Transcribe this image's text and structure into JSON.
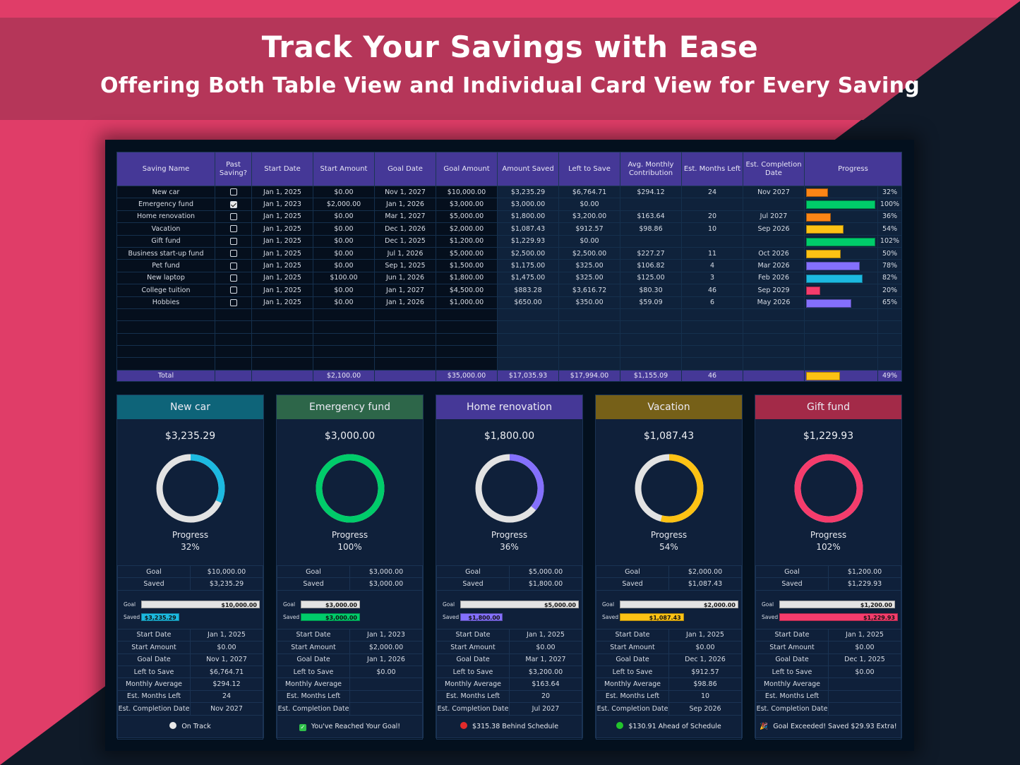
{
  "banner": {
    "title": "Track Your Savings with Ease",
    "subtitle": "Offering Both Table View and Individual Card View for Every Saving"
  },
  "colors": {
    "pink": "#e03d68",
    "banner": "#b53659",
    "dark": "#0f1a28",
    "header_purple": "#453897",
    "orange": "#fb8516",
    "green": "#00cc6a",
    "yellow": "#fdc214",
    "violet": "#8470fd",
    "cyan": "#1cb9e0",
    "red": "#f53c6c",
    "gray": "#e3e3e3"
  },
  "table": {
    "headers": [
      "Saving Name",
      "Past Saving?",
      "Start Date",
      "Start Amount",
      "Goal Date",
      "Goal Amount",
      "Amount Saved",
      "Left to Save",
      "Avg. Monthly Contribution",
      "Est. Months Left",
      "Est. Completion Date",
      "Progress"
    ],
    "rows": [
      {
        "name": "New car",
        "past": false,
        "start_date": "Jan 1, 2025",
        "start_amount": "$0.00",
        "goal_date": "Nov 1, 2027",
        "goal_amount": "$10,000.00",
        "saved": "$3,235.29",
        "left": "$6,764.71",
        "avg": "$294.12",
        "months": "24",
        "completion": "Nov 2027",
        "progress": 0.32,
        "progress_label": "32%",
        "bar_color": "#fb8516"
      },
      {
        "name": "Emergency fund",
        "past": true,
        "start_date": "Jan 1, 2023",
        "start_amount": "$2,000.00",
        "goal_date": "Jan 1, 2026",
        "goal_amount": "$3,000.00",
        "saved": "$3,000.00",
        "left": "$0.00",
        "avg": "",
        "months": "",
        "completion": "",
        "progress": 1.0,
        "progress_label": "100%",
        "bar_color": "#00cc6a"
      },
      {
        "name": "Home renovation",
        "past": false,
        "start_date": "Jan 1, 2025",
        "start_amount": "$0.00",
        "goal_date": "Mar 1, 2027",
        "goal_amount": "$5,000.00",
        "saved": "$1,800.00",
        "left": "$3,200.00",
        "avg": "$163.64",
        "months": "20",
        "completion": "Jul 2027",
        "progress": 0.36,
        "progress_label": "36%",
        "bar_color": "#fb8516"
      },
      {
        "name": "Vacation",
        "past": false,
        "start_date": "Jan 1, 2025",
        "start_amount": "$0.00",
        "goal_date": "Dec 1, 2026",
        "goal_amount": "$2,000.00",
        "saved": "$1,087.43",
        "left": "$912.57",
        "avg": "$98.86",
        "months": "10",
        "completion": "Sep 2026",
        "progress": 0.54,
        "progress_label": "54%",
        "bar_color": "#fdc214"
      },
      {
        "name": "Gift fund",
        "past": false,
        "start_date": "Jan 1, 2025",
        "start_amount": "$0.00",
        "goal_date": "Dec 1, 2025",
        "goal_amount": "$1,200.00",
        "saved": "$1,229.93",
        "left": "$0.00",
        "avg": "",
        "months": "",
        "completion": "",
        "progress": 1.02,
        "progress_label": "102%",
        "bar_color": "#00cc6a"
      },
      {
        "name": "Business start-up fund",
        "past": false,
        "start_date": "Jan 1, 2025",
        "start_amount": "$0.00",
        "goal_date": "Jul 1, 2026",
        "goal_amount": "$5,000.00",
        "saved": "$2,500.00",
        "left": "$2,500.00",
        "avg": "$227.27",
        "months": "11",
        "completion": "Oct 2026",
        "progress": 0.5,
        "progress_label": "50%",
        "bar_color": "#fdc214"
      },
      {
        "name": "Pet fund",
        "past": false,
        "start_date": "Jan 1, 2025",
        "start_amount": "$0.00",
        "goal_date": "Sep 1, 2025",
        "goal_amount": "$1,500.00",
        "saved": "$1,175.00",
        "left": "$325.00",
        "avg": "$106.82",
        "months": "4",
        "completion": "Mar 2026",
        "progress": 0.78,
        "progress_label": "78%",
        "bar_color": "#8470fd"
      },
      {
        "name": "New laptop",
        "past": false,
        "start_date": "Jan 1, 2025",
        "start_amount": "$100.00",
        "goal_date": "Jun 1, 2026",
        "goal_amount": "$1,800.00",
        "saved": "$1,475.00",
        "left": "$325.00",
        "avg": "$125.00",
        "months": "3",
        "completion": "Feb 2026",
        "progress": 0.82,
        "progress_label": "82%",
        "bar_color": "#1cb9e0"
      },
      {
        "name": "College tuition",
        "past": false,
        "start_date": "Jan 1, 2025",
        "start_amount": "$0.00",
        "goal_date": "Jan 1, 2027",
        "goal_amount": "$4,500.00",
        "saved": "$883.28",
        "left": "$3,616.72",
        "avg": "$80.30",
        "months": "46",
        "completion": "Sep 2029",
        "progress": 0.2,
        "progress_label": "20%",
        "bar_color": "#f53c6c"
      },
      {
        "name": "Hobbies",
        "past": false,
        "start_date": "Jan 1, 2025",
        "start_amount": "$0.00",
        "goal_date": "Jan 1, 2026",
        "goal_amount": "$1,000.00",
        "saved": "$650.00",
        "left": "$350.00",
        "avg": "$59.09",
        "months": "6",
        "completion": "May 2026",
        "progress": 0.65,
        "progress_label": "65%",
        "bar_color": "#8470fd"
      }
    ],
    "empty_rows": 5,
    "total": {
      "label": "Total",
      "start_amount": "$2,100.00",
      "goal_amount": "$35,000.00",
      "saved": "$17,035.93",
      "left": "$17,994.00",
      "avg": "$1,155.09",
      "months": "46",
      "progress": 0.49,
      "progress_label": "49%",
      "bar_color": "#fdc214"
    }
  },
  "cards": [
    {
      "name": "New car",
      "header_color": "#0e6479",
      "amount": "$3,235.29",
      "ring_color": "#1cb9e0",
      "progress": 0.32,
      "progress_title": "Progress",
      "progress_label": "32%",
      "goal_label": "Goal",
      "goal": "$10,000.00",
      "saved_label": "Saved",
      "saved": "$3,235.29",
      "mini_goal_frac": 1.0,
      "mini_saved_frac": 0.32,
      "details": [
        [
          "Start Date",
          "Jan 1, 2025"
        ],
        [
          "Start Amount",
          "$0.00"
        ],
        [
          "Goal Date",
          "Nov 1, 2027"
        ],
        [
          "Left to Save",
          "$6,764.71"
        ],
        [
          "Monthly Average",
          "$294.12"
        ],
        [
          "Est. Months Left",
          "24"
        ],
        [
          "Est. Completion Date",
          "Nov 2027"
        ]
      ],
      "status_icon": "white-circle",
      "status_color": "#e8e8e8",
      "status": "On Track"
    },
    {
      "name": "Emergency fund",
      "header_color": "#2d6649",
      "amount": "$3,000.00",
      "ring_color": "#00cc6a",
      "progress": 1.0,
      "progress_title": "Progress",
      "progress_label": "100%",
      "goal_label": "Goal",
      "goal": "$3,000.00",
      "saved_label": "Saved",
      "saved": "$3,000.00",
      "mini_goal_frac": 0.5,
      "mini_saved_frac": 0.5,
      "details": [
        [
          "Start Date",
          "Jan 1, 2023"
        ],
        [
          "Start Amount",
          "$2,000.00"
        ],
        [
          "Goal Date",
          "Jan 1, 2026"
        ],
        [
          "Left to Save",
          "$0.00"
        ],
        [
          "Monthly Average",
          ""
        ],
        [
          "Est. Months Left",
          ""
        ],
        [
          "Est. Completion Date",
          ""
        ]
      ],
      "status_icon": "check-box",
      "status_color": "#2fbf4a",
      "status": "You've Reached Your Goal!"
    },
    {
      "name": "Home renovation",
      "header_color": "#453897",
      "amount": "$1,800.00",
      "ring_color": "#8470fd",
      "progress": 0.36,
      "progress_title": "Progress",
      "progress_label": "36%",
      "goal_label": "Goal",
      "goal": "$5,000.00",
      "saved_label": "Saved",
      "saved": "$1,800.00",
      "mini_goal_frac": 1.0,
      "mini_saved_frac": 0.36,
      "details": [
        [
          "Start Date",
          "Jan 1, 2025"
        ],
        [
          "Start Amount",
          "$0.00"
        ],
        [
          "Goal Date",
          "Mar 1, 2027"
        ],
        [
          "Left to Save",
          "$3,200.00"
        ],
        [
          "Monthly Average",
          "$163.64"
        ],
        [
          "Est. Months Left",
          "20"
        ],
        [
          "Est. Completion Date",
          "Jul 2027"
        ]
      ],
      "status_icon": "red-circle",
      "status_color": "#e22b2b",
      "status": "$315.38 Behind Schedule"
    },
    {
      "name": "Vacation",
      "header_color": "#766018",
      "amount": "$1,087.43",
      "ring_color": "#fdc214",
      "progress": 0.54,
      "progress_title": "Progress",
      "progress_label": "54%",
      "goal_label": "Goal",
      "goal": "$2,000.00",
      "saved_label": "Saved",
      "saved": "$1,087.43",
      "mini_goal_frac": 1.0,
      "mini_saved_frac": 0.54,
      "details": [
        [
          "Start Date",
          "Jan 1, 2025"
        ],
        [
          "Start Amount",
          "$0.00"
        ],
        [
          "Goal Date",
          "Dec 1, 2026"
        ],
        [
          "Left to Save",
          "$912.57"
        ],
        [
          "Monthly Average",
          "$98.86"
        ],
        [
          "Est. Months Left",
          "10"
        ],
        [
          "Est. Completion Date",
          "Sep 2026"
        ]
      ],
      "status_icon": "green-circle",
      "status_color": "#22c42c",
      "status": "$130.91 Ahead of Schedule"
    },
    {
      "name": "Gift fund",
      "header_color": "#a32a48",
      "amount": "$1,229.93",
      "ring_color": "#f53c6c",
      "progress": 1.02,
      "progress_title": "Progress",
      "progress_label": "102%",
      "goal_label": "Goal",
      "goal": "$1,200.00",
      "saved_label": "Saved",
      "saved": "$1,229.93",
      "mini_goal_frac": 0.976,
      "mini_saved_frac": 1.0,
      "details": [
        [
          "Start Date",
          "Jan 1, 2025"
        ],
        [
          "Start Amount",
          "$0.00"
        ],
        [
          "Goal Date",
          "Dec 1, 2025"
        ],
        [
          "Left to Save",
          "$0.00"
        ],
        [
          "Monthly Average",
          ""
        ],
        [
          "Est. Months Left",
          ""
        ],
        [
          "Est. Completion Date",
          ""
        ]
      ],
      "status_icon": "party-popper",
      "status_color": "#f2b233",
      "status": "Goal Exceeded! Saved $29.93 Extra!"
    }
  ]
}
